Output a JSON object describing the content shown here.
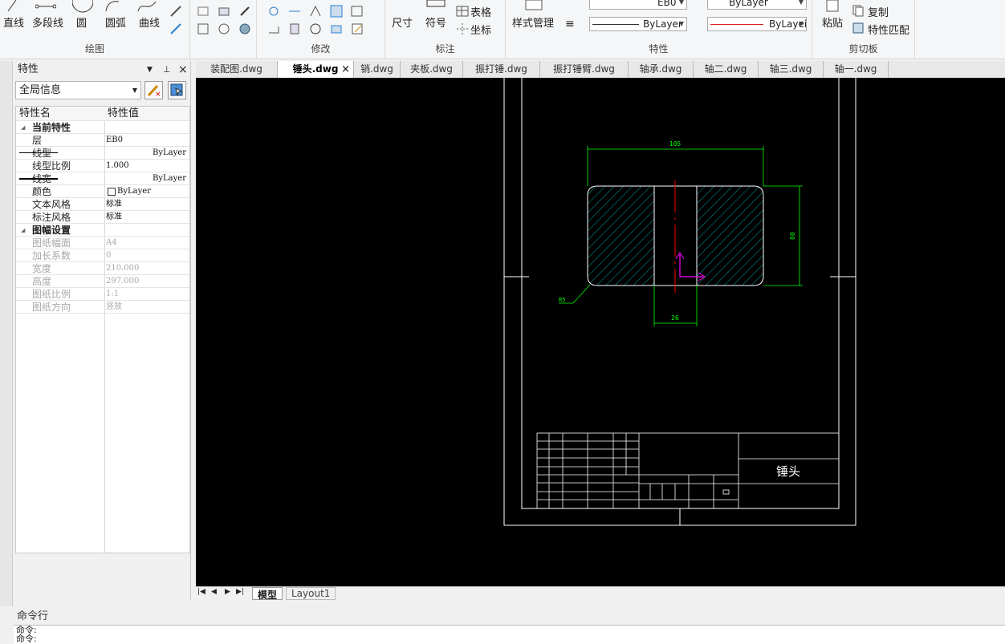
{
  "ribbon": {
    "groups": {
      "draw": "绘图",
      "modify": "修改",
      "annotate": "标注",
      "properties": "特性",
      "clipboard": "剪切板"
    },
    "draw_buttons": [
      "直线",
      "多段线",
      "圆",
      "圆弧",
      "曲线"
    ],
    "annotate_buttons": {
      "dimension": "尺寸",
      "symbol": "符号",
      "table": "表格",
      "coord": "坐标"
    },
    "style_manager": "样式管理",
    "layer_combo": "EB0",
    "color_combo": "ByLayer",
    "linetype_combo": "ByLayer",
    "lineweight_combo": "ByLayei",
    "paste": "粘贴",
    "copy": "复制",
    "match_props": "特性匹配"
  },
  "panel": {
    "title": "特性",
    "selector": "全局信息",
    "col_name": "特性名",
    "col_value": "特性值",
    "rows": [
      {
        "k": "当前特性",
        "v": "",
        "type": "cat"
      },
      {
        "k": "层",
        "v": "EB0",
        "type": "n"
      },
      {
        "k": "线型",
        "v": "ByLayer",
        "type": "line"
      },
      {
        "k": "线型比例",
        "v": "1.000",
        "type": "n"
      },
      {
        "k": "线宽",
        "v": "ByLayer",
        "type": "line2"
      },
      {
        "k": "颜色",
        "v": "ByLayer",
        "type": "color"
      },
      {
        "k": "文本风格",
        "v": "标准",
        "type": "n"
      },
      {
        "k": "标注风格",
        "v": "标准",
        "type": "n"
      },
      {
        "k": "图幅设置",
        "v": "",
        "type": "cat"
      },
      {
        "k": "图纸幅面",
        "v": "A4",
        "type": "dis"
      },
      {
        "k": "加长系数",
        "v": "0",
        "type": "dis"
      },
      {
        "k": "宽度",
        "v": "210.000",
        "type": "dis"
      },
      {
        "k": "高度",
        "v": "297.000",
        "type": "dis"
      },
      {
        "k": "图纸比例",
        "v": "1:1",
        "type": "dis"
      },
      {
        "k": "图纸方向",
        "v": "竖放",
        "type": "dis"
      }
    ]
  },
  "tabs": [
    {
      "label": "装配图.dwg",
      "active": false
    },
    {
      "label": "锤头.dwg",
      "active": true
    },
    {
      "label": "销.dwg",
      "active": false
    },
    {
      "label": "夹板.dwg",
      "active": false
    },
    {
      "label": "振打锤.dwg",
      "active": false
    },
    {
      "label": "振打锤臂.dwg",
      "active": false
    },
    {
      "label": "轴承.dwg",
      "active": false
    },
    {
      "label": "轴二.dwg",
      "active": false
    },
    {
      "label": "轴三.dwg",
      "active": false
    },
    {
      "label": "轴一.dwg",
      "active": false
    }
  ],
  "drawing": {
    "dim_width": "105",
    "dim_height": "60",
    "dim_slot": "26",
    "dim_radius": "R5",
    "title_text": "锤头"
  },
  "layout_tabs": {
    "model": "模型",
    "layout1": "Layout1"
  },
  "command": {
    "title": "命令行",
    "line1": "命令:",
    "line2": "命令:"
  },
  "colors": {
    "canvas": "#000000",
    "dim": "#00ff00",
    "hatch": "#00c8c8",
    "center": "#ff0000",
    "ucs": "#ff00ff"
  }
}
